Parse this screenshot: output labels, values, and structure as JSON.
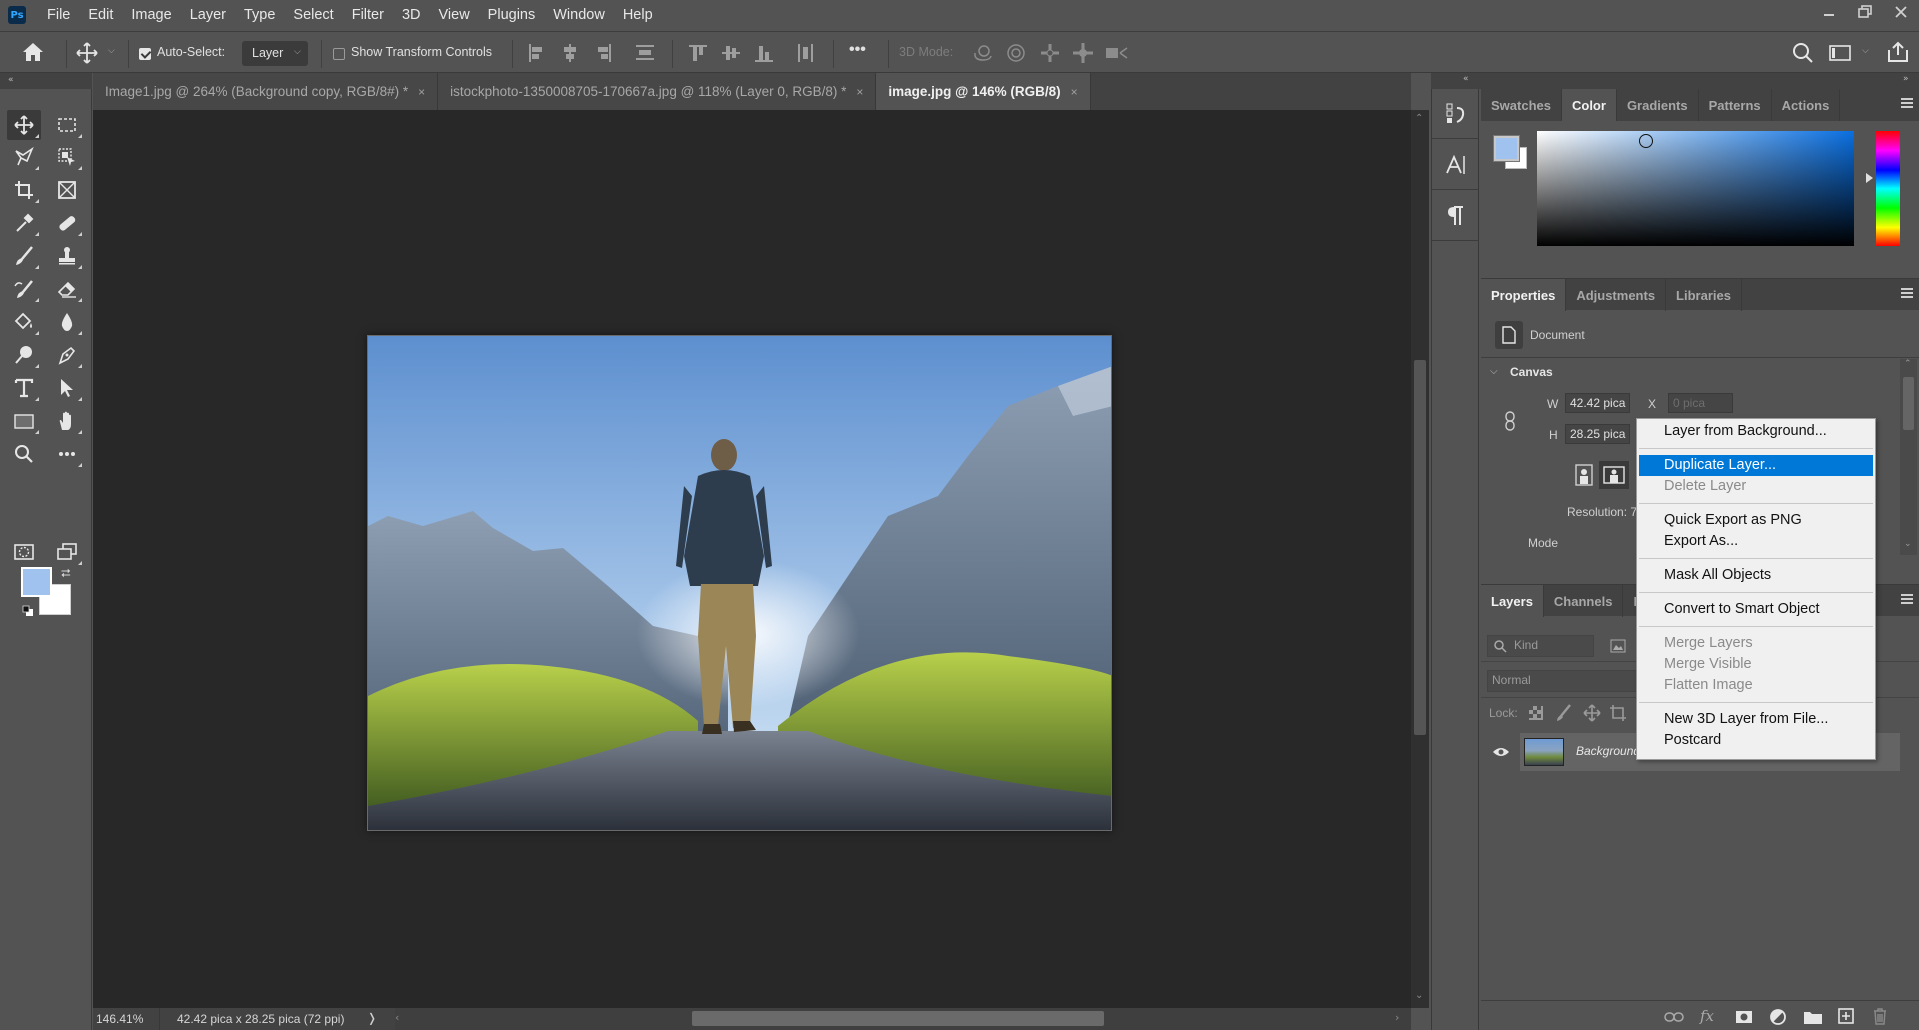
{
  "app": {
    "logo": "Ps",
    "name": "Photoshop"
  },
  "menubar": [
    "File",
    "Edit",
    "Image",
    "Layer",
    "Type",
    "Select",
    "Filter",
    "3D",
    "View",
    "Plugins",
    "Window",
    "Help"
  ],
  "window_controls": {
    "minimize": "minimize-icon",
    "restore": "restore-icon",
    "close": "close-icon"
  },
  "options_bar": {
    "auto_select_label": "Auto-Select:",
    "auto_select_checked": true,
    "auto_select_target": "Layer",
    "show_transform_label": "Show Transform Controls",
    "show_transform_checked": false,
    "more_label": "•••",
    "mode_3d_label": "3D Mode:"
  },
  "toolbar": {
    "collapse": "«",
    "tools": [
      {
        "name": "move-tool",
        "active": true
      },
      {
        "name": "rectangular-marquee-tool"
      },
      {
        "name": "lasso-tool"
      },
      {
        "name": "object-selection-tool"
      },
      {
        "name": "crop-tool"
      },
      {
        "name": "frame-tool"
      },
      {
        "name": "eyedropper-tool"
      },
      {
        "name": "healing-brush-tool"
      },
      {
        "name": "brush-tool"
      },
      {
        "name": "clone-stamp-tool"
      },
      {
        "name": "history-brush-tool"
      },
      {
        "name": "eraser-tool"
      },
      {
        "name": "paint-bucket-tool"
      },
      {
        "name": "blur-tool"
      },
      {
        "name": "dodge-tool"
      },
      {
        "name": "pen-tool"
      },
      {
        "name": "type-tool"
      },
      {
        "name": "path-selection-tool"
      },
      {
        "name": "rectangle-tool"
      },
      {
        "name": "hand-tool"
      },
      {
        "name": "zoom-tool"
      },
      {
        "name": "edit-toolbar"
      }
    ],
    "foreground_color": "#9fc2ee",
    "background_color": "#ffffff"
  },
  "document_tabs": [
    {
      "label": "Image1.jpg @ 264% (Background copy, RGB/8#) *",
      "active": false
    },
    {
      "label": "istockphoto-1350008705-170667a.jpg @ 118% (Layer 0, RGB/8) *",
      "active": false
    },
    {
      "label": "image.jpg @ 146% (RGB/8)",
      "active": true
    }
  ],
  "tab_close": "×",
  "status_bar": {
    "zoom": "146.41%",
    "doc_info": "42.42 pica x 28.25 pica (72 ppi)",
    "arrow": "❭"
  },
  "color_panel": {
    "tabs": [
      "Swatches",
      "Color",
      "Gradients",
      "Patterns",
      "Actions"
    ],
    "active_tab": "Color",
    "foreground": "#9fc2ee",
    "background": "#ffffff"
  },
  "properties_panel": {
    "tabs": [
      "Properties",
      "Adjustments",
      "Libraries"
    ],
    "active_tab": "Properties",
    "type_label": "Document",
    "section": "Canvas",
    "w_label": "W",
    "w_value": "42.42 pica",
    "h_label": "H",
    "h_value": "28.25 pica",
    "x_label": "X",
    "x_placeholder": "0 pica",
    "resolution_label": "Resolution: 7",
    "mode_label": "Mode"
  },
  "layers_panel": {
    "tabs": [
      "Layers",
      "Channels",
      "Pa"
    ],
    "active_tab": "Layers",
    "filter_label": "Kind",
    "blend_mode": "Normal",
    "lock_label": "Lock:",
    "layers": [
      {
        "name": "Background",
        "visible": true,
        "italic": true
      }
    ],
    "footer_icons": [
      "link-layers-icon",
      "fx-icon",
      "add-mask-icon",
      "adjustment-layer-icon",
      "new-group-icon",
      "new-layer-icon",
      "delete-layer-icon"
    ],
    "fx_label": "fx"
  },
  "context_menu": {
    "groups": [
      [
        {
          "label": "Layer from Background...",
          "enabled": true
        }
      ],
      [
        {
          "label": "Duplicate Layer...",
          "enabled": true,
          "highlighted": true
        },
        {
          "label": "Delete Layer",
          "enabled": false
        }
      ],
      [
        {
          "label": "Quick Export as PNG",
          "enabled": true
        },
        {
          "label": "Export As...",
          "enabled": true
        }
      ],
      [
        {
          "label": "Mask All Objects",
          "enabled": true
        }
      ],
      [
        {
          "label": "Convert to Smart Object",
          "enabled": true
        }
      ],
      [
        {
          "label": "Merge Layers",
          "enabled": false
        },
        {
          "label": "Merge Visible",
          "enabled": false
        },
        {
          "label": "Flatten Image",
          "enabled": false
        }
      ],
      [
        {
          "label": "New 3D Layer from File...",
          "enabled": true
        },
        {
          "label": "Postcard",
          "enabled": true
        }
      ]
    ]
  },
  "colors": {
    "highlight": "#0078d7",
    "canvas_bg": "#282828",
    "panel_bg": "#535353"
  }
}
